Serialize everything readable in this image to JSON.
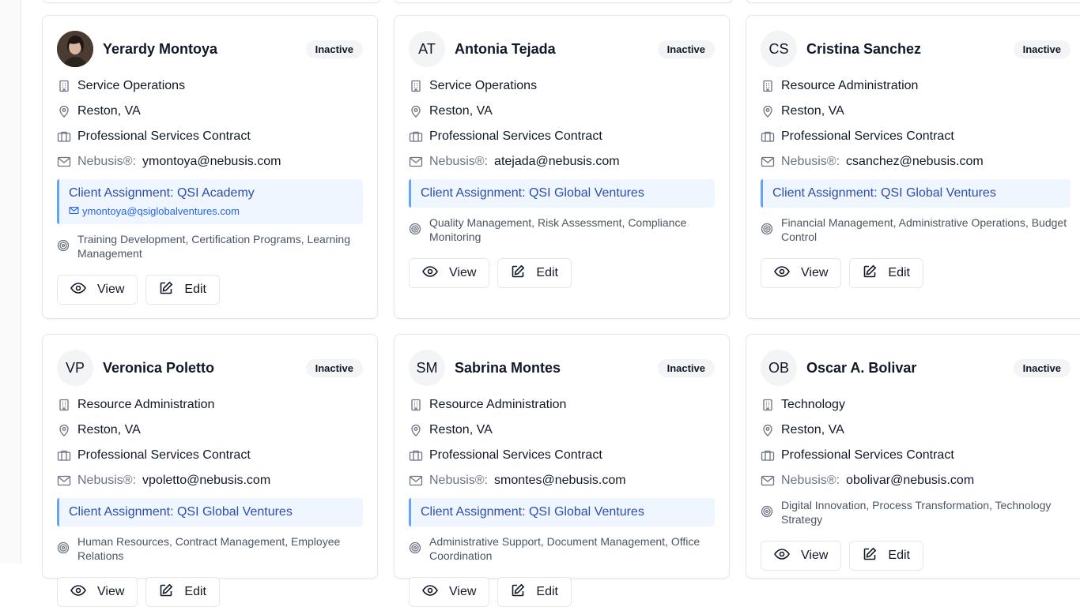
{
  "labels": {
    "status": "Inactive",
    "email_prefix": "Nebusis®:",
    "client_prefix": "Client Assignment: ",
    "view_button": "View",
    "edit_button": "Edit"
  },
  "employees": [
    {
      "name": "Yerardy Montoya",
      "initials": "",
      "has_photo": true,
      "department": "Service Operations",
      "location": "Reston, VA",
      "contract": "Professional Services Contract",
      "email": "ymontoya@nebusis.com",
      "client": "QSI Academy",
      "client_email": "ymontoya@qsiglobalventures.com",
      "skills": "Training Development, Certification Programs, Learning Management"
    },
    {
      "name": "Antonia Tejada",
      "initials": "AT",
      "has_photo": false,
      "department": "Service Operations",
      "location": "Reston, VA",
      "contract": "Professional Services Contract",
      "email": "atejada@nebusis.com",
      "client": "QSI Global Ventures",
      "client_email": "",
      "skills": "Quality Management, Risk Assessment, Compliance Monitoring"
    },
    {
      "name": "Cristina Sanchez",
      "initials": "CS",
      "has_photo": false,
      "department": "Resource Administration",
      "location": "Reston, VA",
      "contract": "Professional Services Contract",
      "email": "csanchez@nebusis.com",
      "client": "QSI Global Ventures",
      "client_email": "",
      "skills": "Financial Management, Administrative Operations, Budget Control"
    },
    {
      "name": "Veronica Poletto",
      "initials": "VP",
      "has_photo": false,
      "department": "Resource Administration",
      "location": "Reston, VA",
      "contract": "Professional Services Contract",
      "email": "vpoletto@nebusis.com",
      "client": "QSI Global Ventures",
      "client_email": "",
      "skills": "Human Resources, Contract Management, Employee Relations"
    },
    {
      "name": "Sabrina Montes",
      "initials": "SM",
      "has_photo": false,
      "department": "Resource Administration",
      "location": "Reston, VA",
      "contract": "Professional Services Contract",
      "email": "smontes@nebusis.com",
      "client": "QSI Global Ventures",
      "client_email": "",
      "skills": "Administrative Support, Document Management, Office Coordination"
    },
    {
      "name": "Oscar A. Bolivar",
      "initials": "OB",
      "has_photo": false,
      "department": "Technology",
      "location": "Reston, VA",
      "contract": "Professional Services Contract",
      "email": "obolivar@nebusis.com",
      "client": "",
      "client_email": "",
      "skills": "Digital Innovation, Process Transformation, Technology Strategy"
    }
  ]
}
